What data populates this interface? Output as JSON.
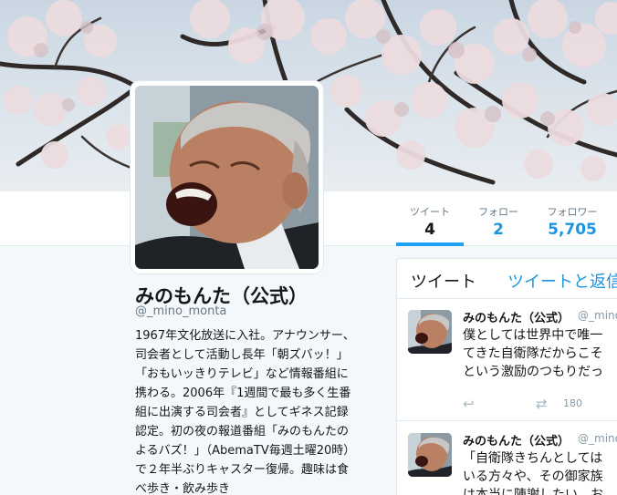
{
  "profile": {
    "name": "みのもんた（公式）",
    "handle": "@_mino_monta",
    "bio_lines": [
      "1967年文化放送に入社。アナウンサー、",
      "司会者として活動し長年「朝ズバッ！」",
      "「おもいッきりテレビ」など情報番組に",
      "携わる。2006年『1週間で最も多く生番",
      "組に出演する司会者』としてギネス記録",
      "認定。初の夜の報道番組「みのもんたの",
      "よるバズ！」（AbemaTV毎週土曜20時）",
      "で２年半ぶりキャスター復帰。趣味は食",
      "べ歩き・飲み歩き"
    ]
  },
  "stats": {
    "tweets": {
      "label": "ツイート",
      "value": "4"
    },
    "following": {
      "label": "フォロー",
      "value": "2"
    },
    "followers": {
      "label": "フォロワー",
      "value": "5,705"
    }
  },
  "timeline": {
    "tabs": [
      "ツイート",
      "ツイートと返信"
    ],
    "tweets": [
      {
        "name": "みのもんた（公式）",
        "handle": "@_mino",
        "lines": [
          "僕としては世界中で唯一",
          "てきた自衛隊だからこそ",
          "という激励のつもりだっ"
        ],
        "retweets": "180"
      },
      {
        "name": "みのもんた（公式）",
        "handle": "@_mino",
        "lines": [
          "「自衛隊きちんとしては",
          "いる方々や、その御家族",
          "は本当に陳謝したい。お"
        ],
        "retweets": ""
      }
    ]
  },
  "icons": {
    "reply": "reply-icon",
    "retweet": "retweet-icon",
    "like": "heart-icon"
  },
  "colors": {
    "accent": "#1da1f2",
    "link": "#1b95e0",
    "muted": "#657786"
  }
}
